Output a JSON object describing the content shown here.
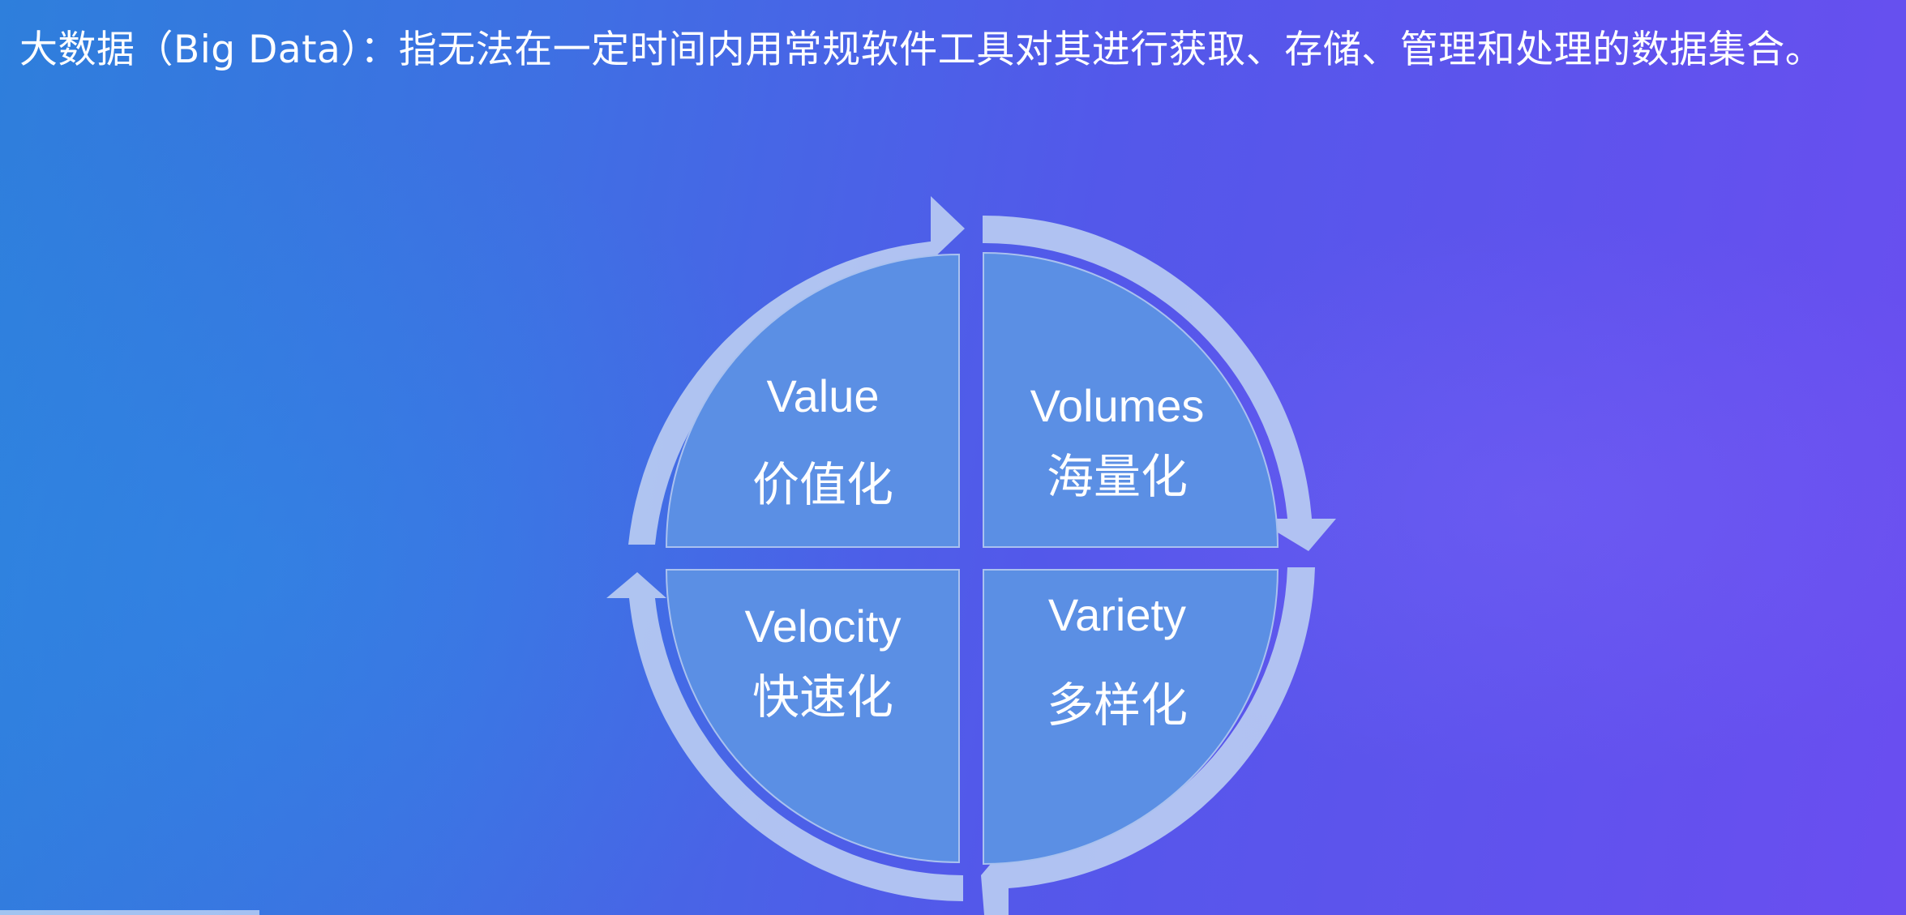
{
  "headline": "大数据（Big Data）：指无法在一定时间内用常规软件工具对其进行获取、存储、管理和处理的数据集合。",
  "quadrants": [
    {
      "name": "value",
      "en": "Value",
      "zh": "价值化"
    },
    {
      "name": "volumes",
      "en": "Volumes",
      "zh": "海量化"
    },
    {
      "name": "velocity",
      "en": "Velocity",
      "zh": "快速化"
    },
    {
      "name": "variety",
      "en": "Variety",
      "zh": "多样化"
    }
  ],
  "colors": {
    "quadrant_fill": "#5b8fe4",
    "ring": "#b8cbf2",
    "text": "#ffffff"
  }
}
